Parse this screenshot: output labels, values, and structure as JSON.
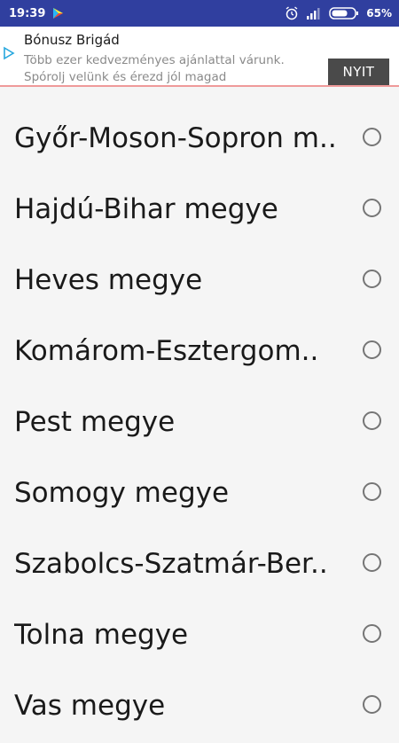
{
  "status_bar": {
    "time": "19:39",
    "battery_percent": "65%",
    "icons": [
      "play-store-icon",
      "alarm-icon",
      "signal-icon",
      "battery-icon"
    ]
  },
  "ad": {
    "title": "Bónusz Brigád",
    "description": "Több ezer kedvezményes ajánlattal várunk. Spórolj velünk és érezd jól magad",
    "button_label": "NYIT",
    "icon": "adchoices-icon"
  },
  "list": {
    "items": [
      {
        "label": "Győr-Moson-Sopron m.."
      },
      {
        "label": "Hajdú-Bihar megye"
      },
      {
        "label": "Heves megye"
      },
      {
        "label": "Komárom-Esztergom.."
      },
      {
        "label": "Pest megye"
      },
      {
        "label": "Somogy megye"
      },
      {
        "label": "Szabolcs-Szatmár-Ber.."
      },
      {
        "label": "Tolna megye"
      },
      {
        "label": "Vas megye"
      }
    ]
  },
  "colors": {
    "status_bar": "#303f9f",
    "background": "#f5f5f5",
    "ad_divider": "#ef9a9a",
    "ad_button": "#4a4a4a",
    "radio_border": "#757575"
  }
}
